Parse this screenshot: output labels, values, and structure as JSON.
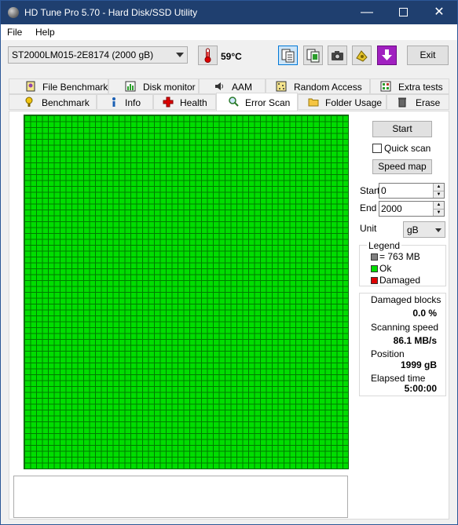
{
  "window": {
    "title": "HD Tune Pro 5.70 - Hard Disk/SSD Utility",
    "min_symbol": "—",
    "close_symbol": "✕"
  },
  "menu": {
    "file": "File",
    "help": "Help"
  },
  "toolbar": {
    "drive": "ST2000LM015-2E8174 (2000 gB)",
    "temperature": "59°C",
    "exit_label": "Exit"
  },
  "tabs": {
    "row1": [
      "File Benchmark",
      "Disk monitor",
      "AAM",
      "Random Access",
      "Extra tests"
    ],
    "row2": [
      "Benchmark",
      "Info",
      "Health",
      "Error Scan",
      "Folder Usage",
      "Erase"
    ],
    "selected": "Error Scan"
  },
  "controls": {
    "start_button": "Start",
    "quick_scan_label": "Quick scan",
    "quick_scan_checked": false,
    "speed_map_button": "Speed map",
    "start_label": "Start",
    "start_value": "0",
    "end_label": "End",
    "end_value": "2000",
    "unit_label": "Unit",
    "unit_value": "gB"
  },
  "legend": {
    "title": "Legend",
    "block": "= 763 MB",
    "ok": "Ok",
    "damaged": "Damaged"
  },
  "stats": {
    "damaged_blocks_label": "Damaged blocks",
    "damaged_blocks_value": "0.0 %",
    "scanning_speed_label": "Scanning speed",
    "scanning_speed_value": "86.1 MB/s",
    "position_label": "Position",
    "position_value": "1999 gB",
    "elapsed_label": "Elapsed time",
    "elapsed_value": "5:00:00"
  },
  "colors": {
    "titlebar": "#1f3f6f",
    "block_ok": "#00dd00",
    "block_grid": "#007a00",
    "legend_block": "#808080",
    "legend_ok": "#00dd00",
    "legend_damaged": "#dd0000"
  },
  "icons": {
    "temperature": "thermometer-icon",
    "toolbar": [
      "copy-text-icon",
      "copy-info-icon",
      "screenshot-camera-icon",
      "options-icon",
      "save-down-arrow-icon"
    ]
  }
}
